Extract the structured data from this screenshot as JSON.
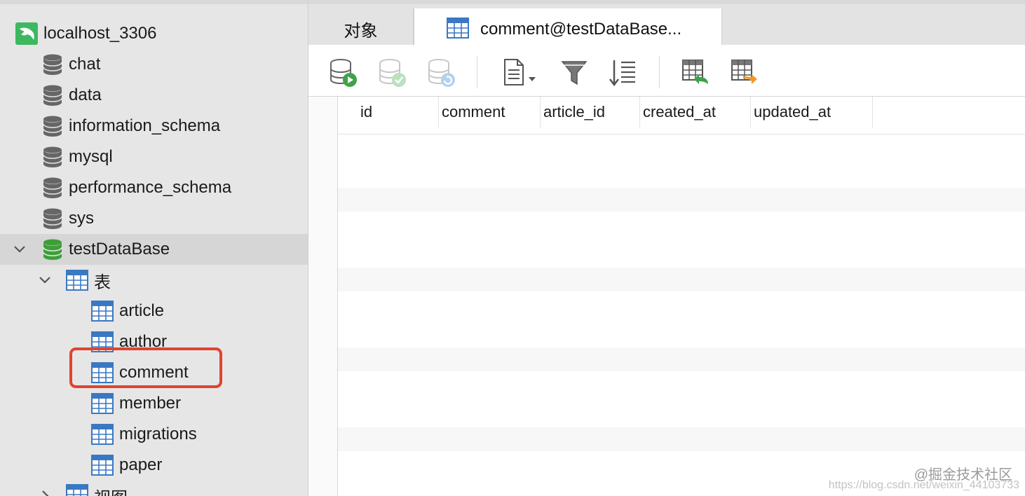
{
  "connection": {
    "name": "localhost_3306",
    "icon": "mysql-dolphin-icon"
  },
  "databases": [
    {
      "name": "chat"
    },
    {
      "name": "data"
    },
    {
      "name": "information_schema"
    },
    {
      "name": "mysql"
    },
    {
      "name": "performance_schema"
    },
    {
      "name": "sys"
    },
    {
      "name": "testDataBase",
      "selected": true,
      "expanded": true
    }
  ],
  "testDataBase": {
    "tables_group_label": "表",
    "tables": [
      "article",
      "author",
      "comment",
      "member",
      "migrations",
      "paper"
    ],
    "views_group_label": "视图"
  },
  "tabs": {
    "objects_label": "对象",
    "active_label": "comment@testDataBase..."
  },
  "grid": {
    "columns": [
      "id",
      "comment",
      "article_id",
      "created_at",
      "updated_at"
    ]
  },
  "watermark": {
    "line1": "@掘金技术社区",
    "line2": "https://blog.csdn.net/weixin_44103733"
  },
  "colors": {
    "db_gray": "#666666",
    "db_green": "#3f9e3a",
    "table_blue": "#3a78c3",
    "highlight_red": "#e0442e"
  }
}
